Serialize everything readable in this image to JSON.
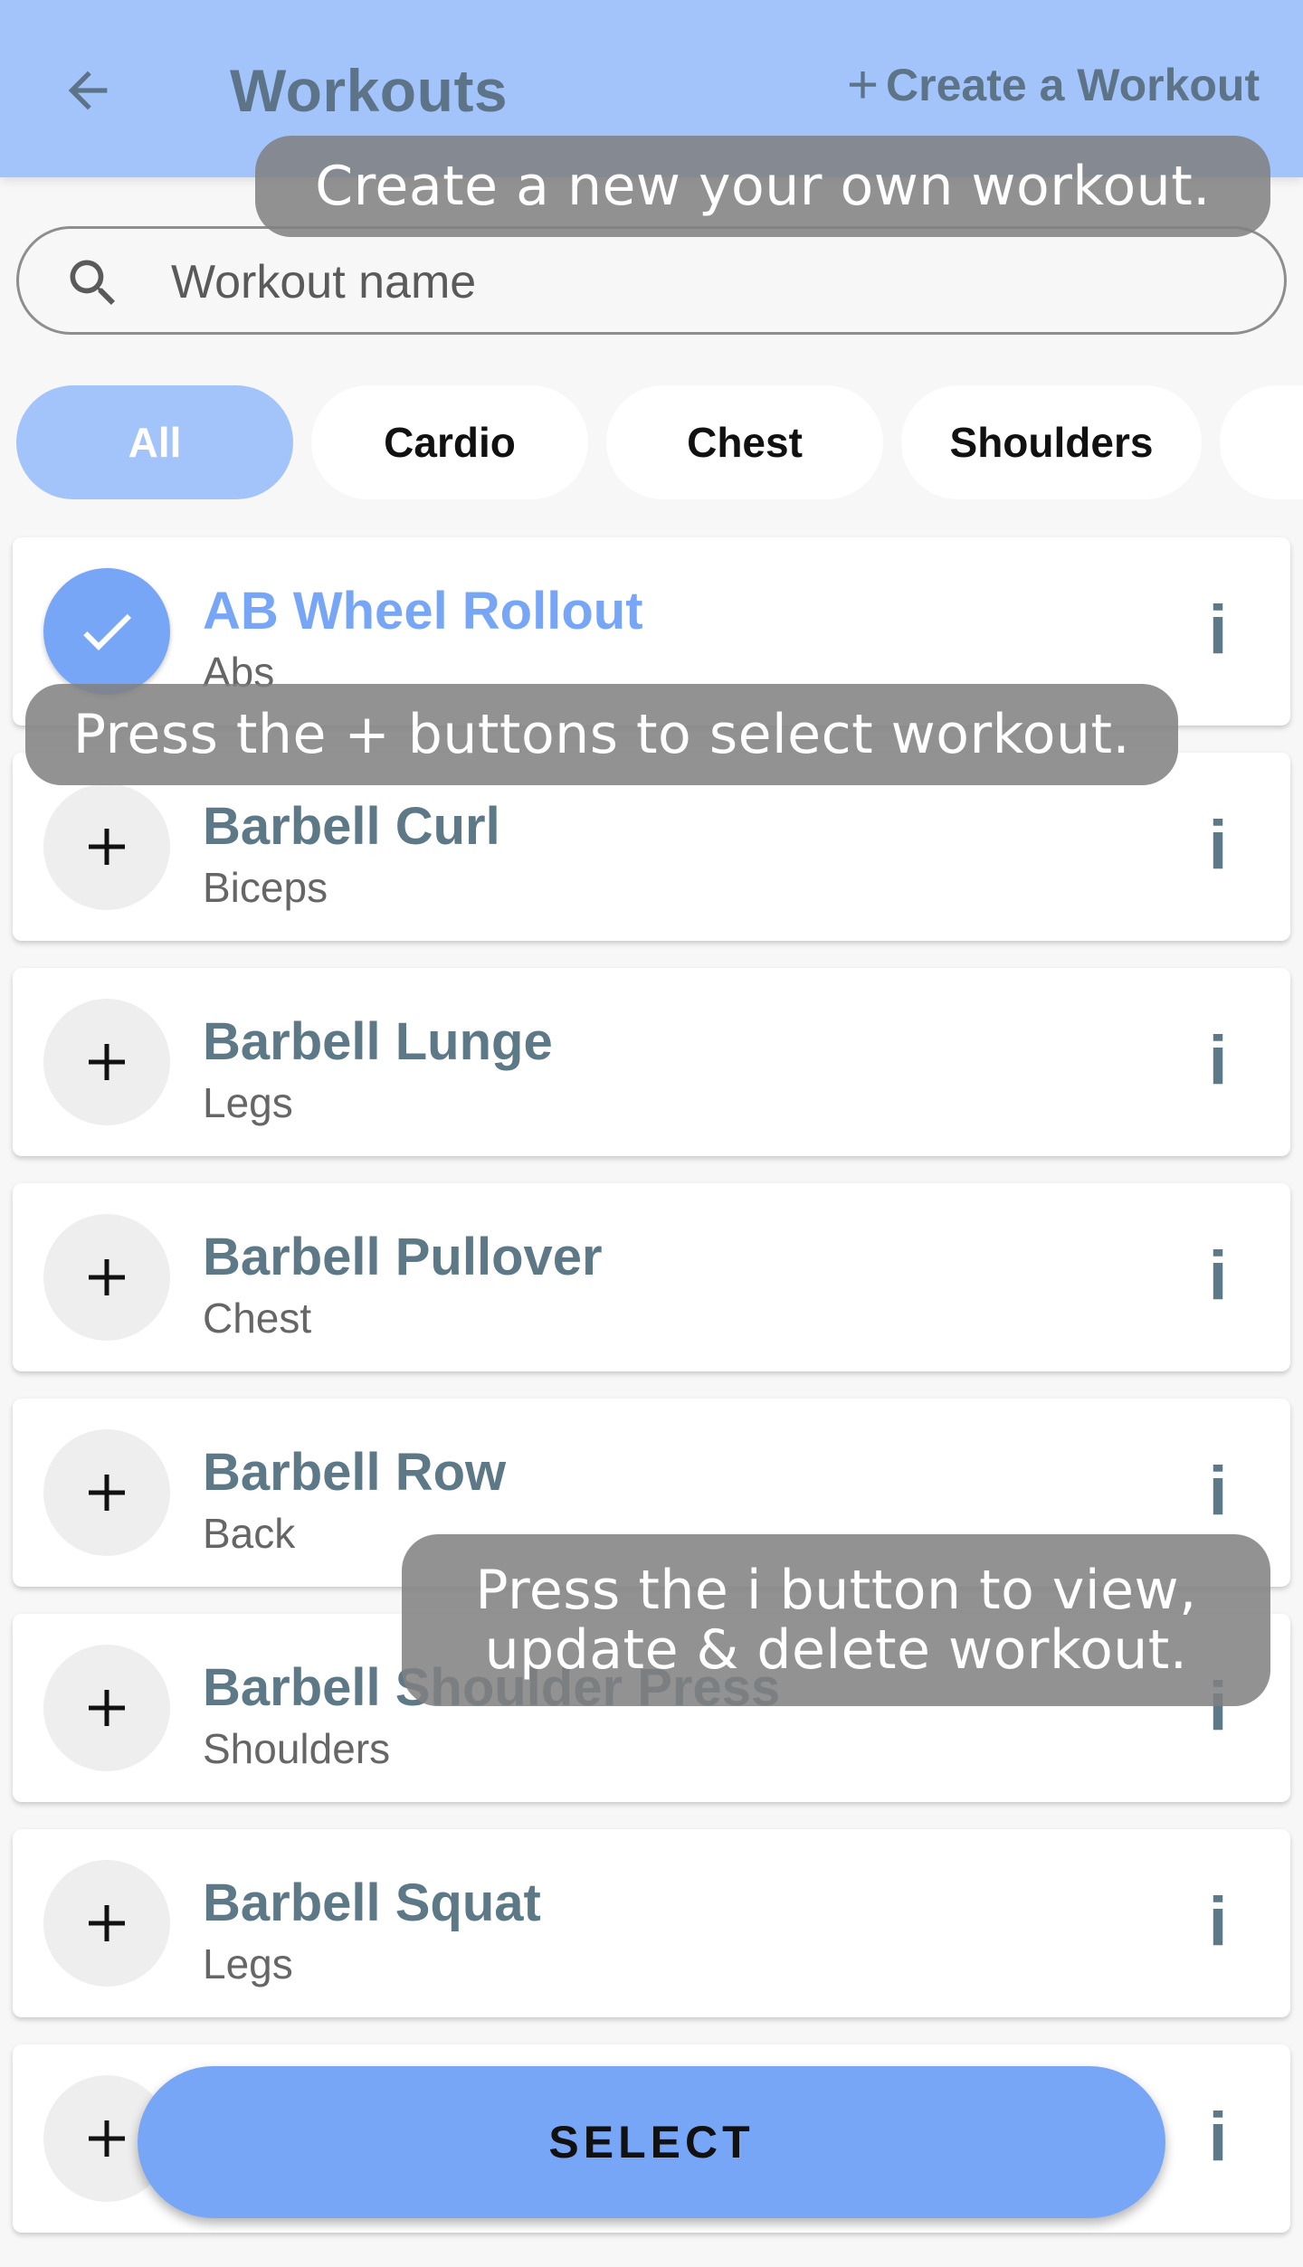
{
  "header": {
    "title": "Workouts",
    "back_icon": "arrow-left-icon",
    "create_label": "Create a Workout",
    "create_icon": "plus-icon",
    "background_color": "#a3c4fa"
  },
  "search": {
    "placeholder": "Workout name",
    "icon": "search-icon"
  },
  "categories": [
    {
      "label": "All",
      "active": true
    },
    {
      "label": "Cardio",
      "active": false
    },
    {
      "label": "Chest",
      "active": false
    },
    {
      "label": "Shoulders",
      "active": false
    },
    {
      "label": "",
      "active": false
    }
  ],
  "exercises": [
    {
      "name": "AB Wheel Rollout",
      "category": "Abs",
      "selected": true
    },
    {
      "name": "Barbell Curl",
      "category": "Biceps",
      "selected": false
    },
    {
      "name": "Barbell Lunge",
      "category": "Legs",
      "selected": false
    },
    {
      "name": "Barbell Pullover",
      "category": "Chest",
      "selected": false
    },
    {
      "name": "Barbell Row",
      "category": "Back",
      "selected": false
    },
    {
      "name": "Barbell Shoulder Press",
      "category": "Shoulders",
      "selected": false
    },
    {
      "name": "Barbell Squat",
      "category": "Legs",
      "selected": false
    },
    {
      "name": "",
      "category": "",
      "selected": false
    }
  ],
  "info_label": "i",
  "tooltips": {
    "create": "Create a new your own workout.",
    "select": "Press the + buttons to select workout.",
    "info": "Press the i button to view, update & delete workout."
  },
  "select_button": {
    "label": "SELECT"
  },
  "colors": {
    "accent": "#78a6f7",
    "header": "#a3c4fa",
    "title_text": "#5d7886",
    "tooltip_bg": "#808080"
  }
}
